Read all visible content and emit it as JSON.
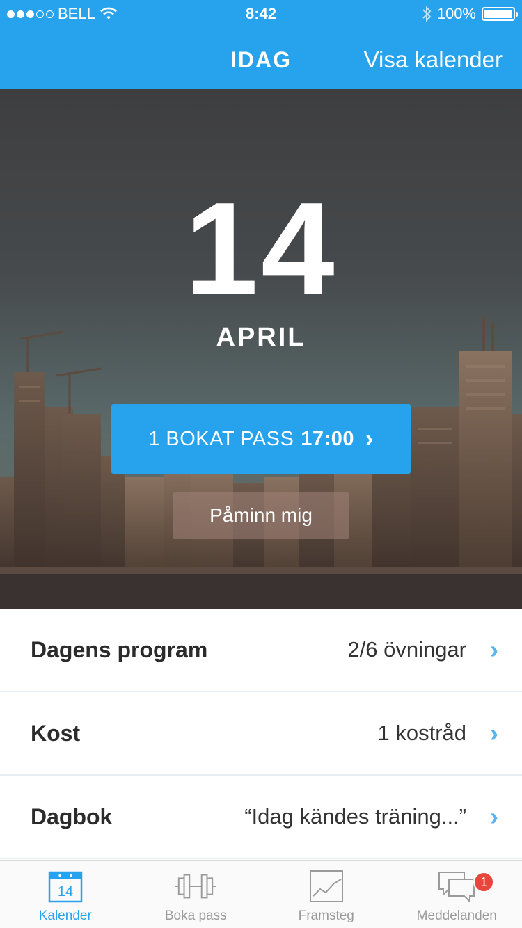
{
  "status_bar": {
    "carrier": "BELL",
    "time": "8:42",
    "battery": "100%",
    "battery_level": 1.0,
    "signal_bars_filled": 3,
    "signal_bars_total": 5
  },
  "nav": {
    "title": "IDAG",
    "right_action": "Visa kalender"
  },
  "hero": {
    "day": "14",
    "month": "APRIL",
    "booked_prefix": "1 BOKAT PASS",
    "booked_time": "17:00",
    "remind_label": "Påminn mig"
  },
  "list": {
    "rows": [
      {
        "label": "Dagens program",
        "value": "2/6 övningar"
      },
      {
        "label": "Kost",
        "value": "1 kostråd"
      },
      {
        "label": "Dagbok",
        "value": "“Idag kändes träning...”"
      }
    ]
  },
  "tabs": [
    {
      "label": "Kalender",
      "icon": "calendar-icon",
      "icon_text": "14",
      "active": true
    },
    {
      "label": "Boka pass",
      "icon": "dumbbell-icon",
      "active": false
    },
    {
      "label": "Framsteg",
      "icon": "chart-icon",
      "active": false
    },
    {
      "label": "Meddelanden",
      "icon": "chat-icon",
      "badge": "1",
      "active": false
    }
  ],
  "colors": {
    "accent": "#27a3ee",
    "badge": "#e8453c",
    "chevron": "#58b6ee"
  }
}
